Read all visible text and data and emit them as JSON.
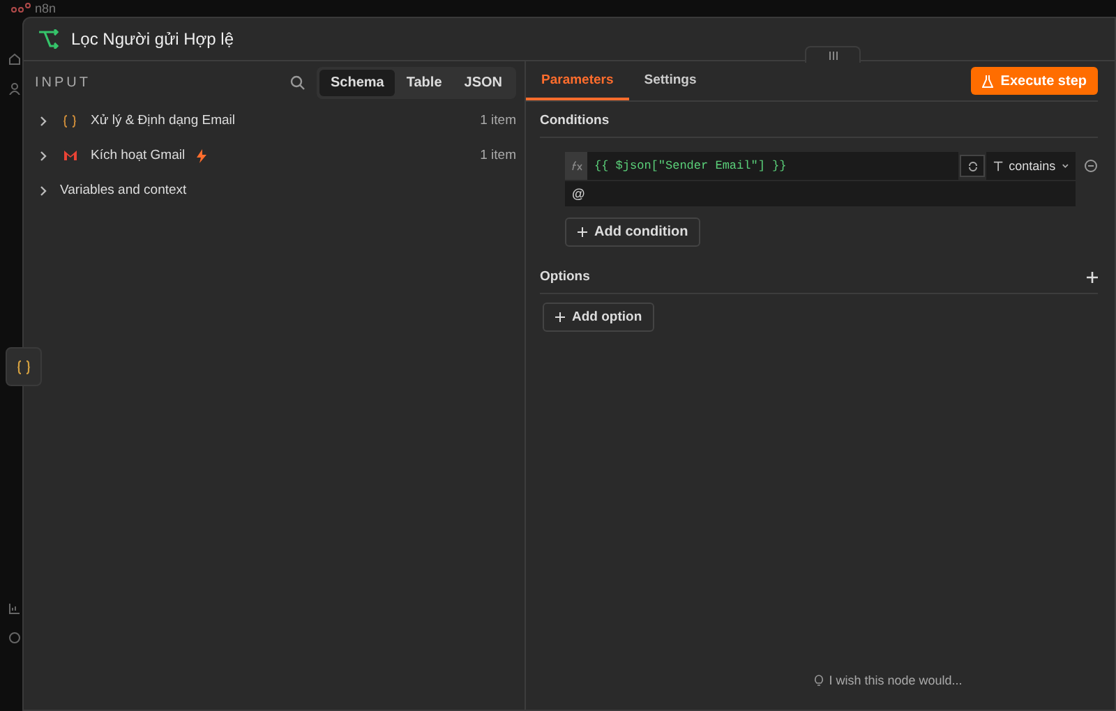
{
  "app": {
    "logo": "n8n"
  },
  "modal": {
    "title": "Lọc Người gửi Hợp lệ"
  },
  "input_panel": {
    "heading": "INPUT",
    "view_tabs": [
      {
        "label": "Schema",
        "selected": true
      },
      {
        "label": "Table",
        "selected": false
      },
      {
        "label": "JSON",
        "selected": false
      }
    ],
    "nodes": [
      {
        "kind": "node",
        "name": "Xử lý & Định dạng Email",
        "trigger": false,
        "count": "1 item"
      },
      {
        "kind": "node",
        "name": "Kích hoạt Gmail",
        "trigger": true,
        "count": "1 item"
      },
      {
        "kind": "group",
        "name": "Variables and context"
      }
    ]
  },
  "params_panel": {
    "tabs": [
      {
        "label": "Parameters",
        "selected": true
      },
      {
        "label": "Settings",
        "selected": false
      }
    ],
    "execute_button": "Execute step",
    "conditions": {
      "heading": "Conditions",
      "left_value": "{{ $json[\"Sender Email\"] }}",
      "operator": "contains",
      "right_value": "@",
      "add_button": "Add condition"
    },
    "options": {
      "heading": "Options",
      "add_button": "Add option"
    },
    "feedback": "I wish this node would..."
  }
}
